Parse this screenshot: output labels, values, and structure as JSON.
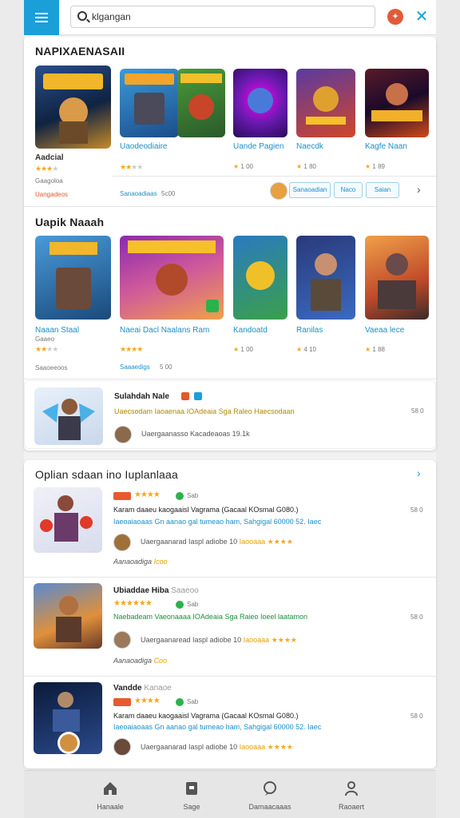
{
  "header": {
    "search_value": "klgangan",
    "search_placeholder": "Search"
  },
  "section1": {
    "title": "NAPIXAENASAII",
    "games": [
      {
        "name": "Aadcial",
        "meta": "Gaagoloa",
        "link": "Uangadeos"
      },
      {
        "name": "Uaodeodiaire",
        "meta": "",
        "link": "Sanaoadiaas"
      },
      {
        "name": "Uande Pagien",
        "meta": "1 00",
        "link": ""
      },
      {
        "name": "Naecdk",
        "meta": "1 80",
        "link": ""
      },
      {
        "name": "Kagfe Naan",
        "meta": "1 89",
        "link": ""
      }
    ],
    "extra_link": "5c00",
    "chips": [
      "Sanaoadian",
      "Naco",
      "Saian"
    ]
  },
  "section2": {
    "title": "Uapik Naaah",
    "games": [
      {
        "name": "Naaan Staal",
        "meta": "Gaaeo",
        "link": "Saaoeeoos"
      },
      {
        "name": "Naeai Dacl Naalans Ram",
        "meta": "",
        "link": "Saaaedigs"
      },
      {
        "name": "Kandoatd",
        "meta": "1 00",
        "link": ""
      },
      {
        "name": "Ranilas",
        "meta": "4 10",
        "link": ""
      },
      {
        "name": "Vaeaa lece",
        "meta": "1 88",
        "link": ""
      }
    ],
    "extra_link": "5 00"
  },
  "featured": {
    "title": "Sulahdah Nale",
    "line": "Uaecsodam Iaoaenaa IOAdeaia Sga Raleo Haecsodaan",
    "size": "58 0",
    "author": "Uaergaanasso Kacadeaoas 19.1k"
  },
  "section3": {
    "title": "Oplian sdaan ino Iuplanlaaa",
    "items": [
      {
        "title": "Karam daaeu kaogaaisl Vagrama (Gacaal KOsmal G080.)",
        "subtitle": "Iaeoaiaoaas Gn aanao gal tumeao ham, Sahgigal 60000 52. Iaec",
        "author": "Uaergaanarad Iaspl adiobe 10",
        "author_b": "Iaooaaa",
        "size": "58 0",
        "footer": "Aanaoadiga",
        "footer_b": "Icoo",
        "badge": "Sab"
      },
      {
        "title": "Ubiaddae Hiba",
        "subtitle": "Naebadeam Vaeonaaaa IOAdeaia Sga Raieo Ioeel laatamon",
        "author": "Uaergaanaread Iaspl adiobe 10",
        "author_b": "Iaooaaa",
        "size": "58 0",
        "footer": "Aanaoadiga",
        "footer_b": "Coo",
        "badge": "Sab",
        "title_b": "Saaeoo"
      },
      {
        "title": "Karam daaeu kaogaaisl Vagrama (Gacaal KOsmal G080.)",
        "subtitle": "Iaeoaiaoaas Gn aanao gal tumeao ham, Sahgigal 60000 52. Iaec",
        "author": "Uaergaanarad Iaspl adiobe 10",
        "author_b": "Iaooaaa",
        "size": "58 0",
        "badge": "Sab",
        "title_top": "Vandde",
        "title_top_b": "Kanaoe"
      }
    ]
  },
  "nav": [
    {
      "label": "Hanaale"
    },
    {
      "label": "Sage"
    },
    {
      "label": "Damaacaaas"
    },
    {
      "label": "Raoaert"
    }
  ],
  "colors": {
    "accent": "#1a9fd9",
    "star": "#f5a623",
    "brand_orange": "#e05a2b"
  }
}
